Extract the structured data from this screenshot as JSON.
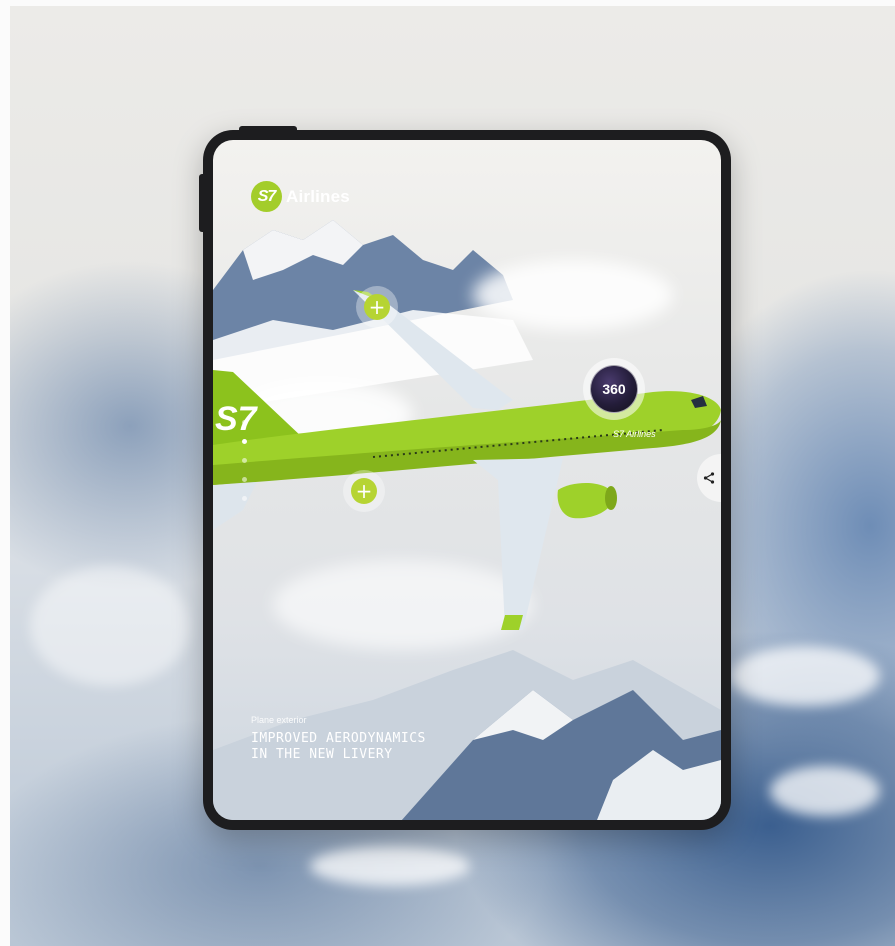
{
  "brand": {
    "logo_mark": "S7",
    "logo_text": "Airlines",
    "accent_color": "#a3cd2a"
  },
  "hotspots": {
    "wing_plus": "+",
    "body_plus": "+",
    "view_360": "360"
  },
  "pagination": {
    "total": 5,
    "active_index": 1
  },
  "share": {
    "icon": "share-icon"
  },
  "caption": {
    "section": "Plane exterior",
    "headline": "IMPROVED AERODYNAMICS\nIN THE NEW LIVERY"
  },
  "plane": {
    "tail_text": "S7",
    "fuselage_text": "S7 Airlines",
    "livery_color": "#9ed12a"
  }
}
